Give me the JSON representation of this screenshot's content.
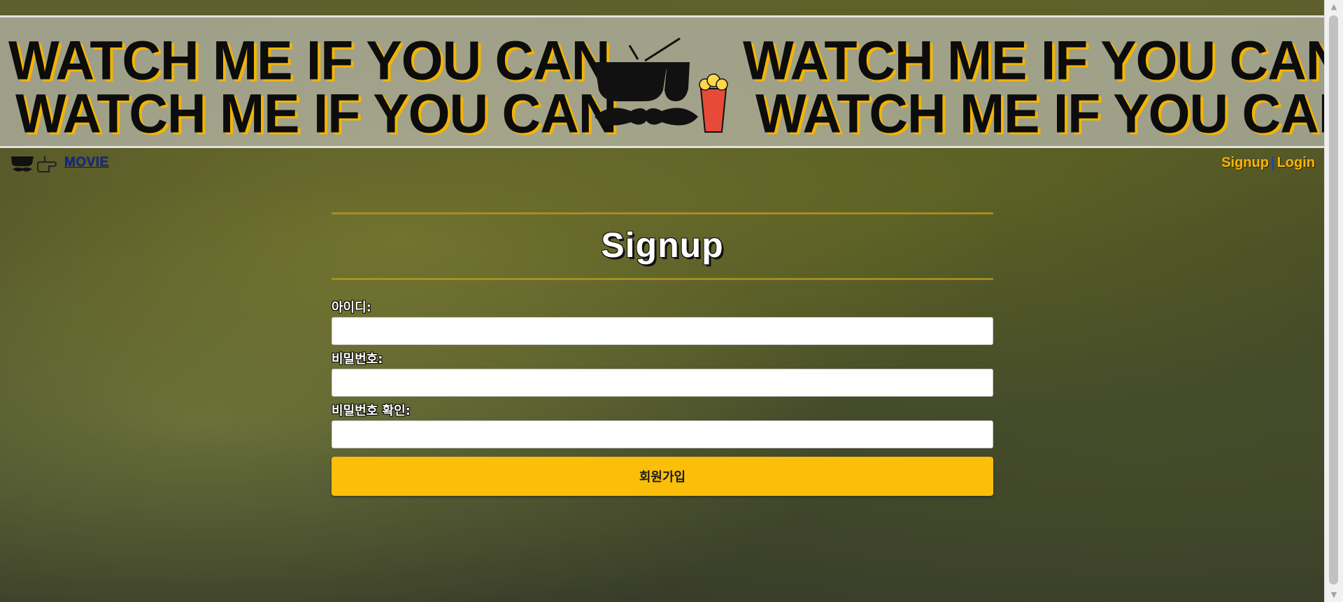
{
  "banner": {
    "line1": "WATCH ME IF YOU CAN",
    "line2": "WATCH ME IF YOU CAN",
    "line3": "WATCH ME IF YOU CAN",
    "line4": "WATCH ME IF YOU CAN",
    "accent_color": "#f3b405"
  },
  "nav": {
    "movie_label": "MOVIE",
    "signup_label": "Signup",
    "separator": "|",
    "login_label": "Login"
  },
  "form": {
    "title": "Signup",
    "id_label": "아이디:",
    "password_label": "비밀번호:",
    "password_confirm_label": "비밀번호 확인:",
    "id_value": "",
    "password_value": "",
    "password_confirm_value": "",
    "submit_label": "회원가입",
    "button_color": "#fbbf0a"
  },
  "icons": [
    "sunglasses-mustache-logo-icon",
    "pointing-hand-icon",
    "popcorn-icon"
  ]
}
